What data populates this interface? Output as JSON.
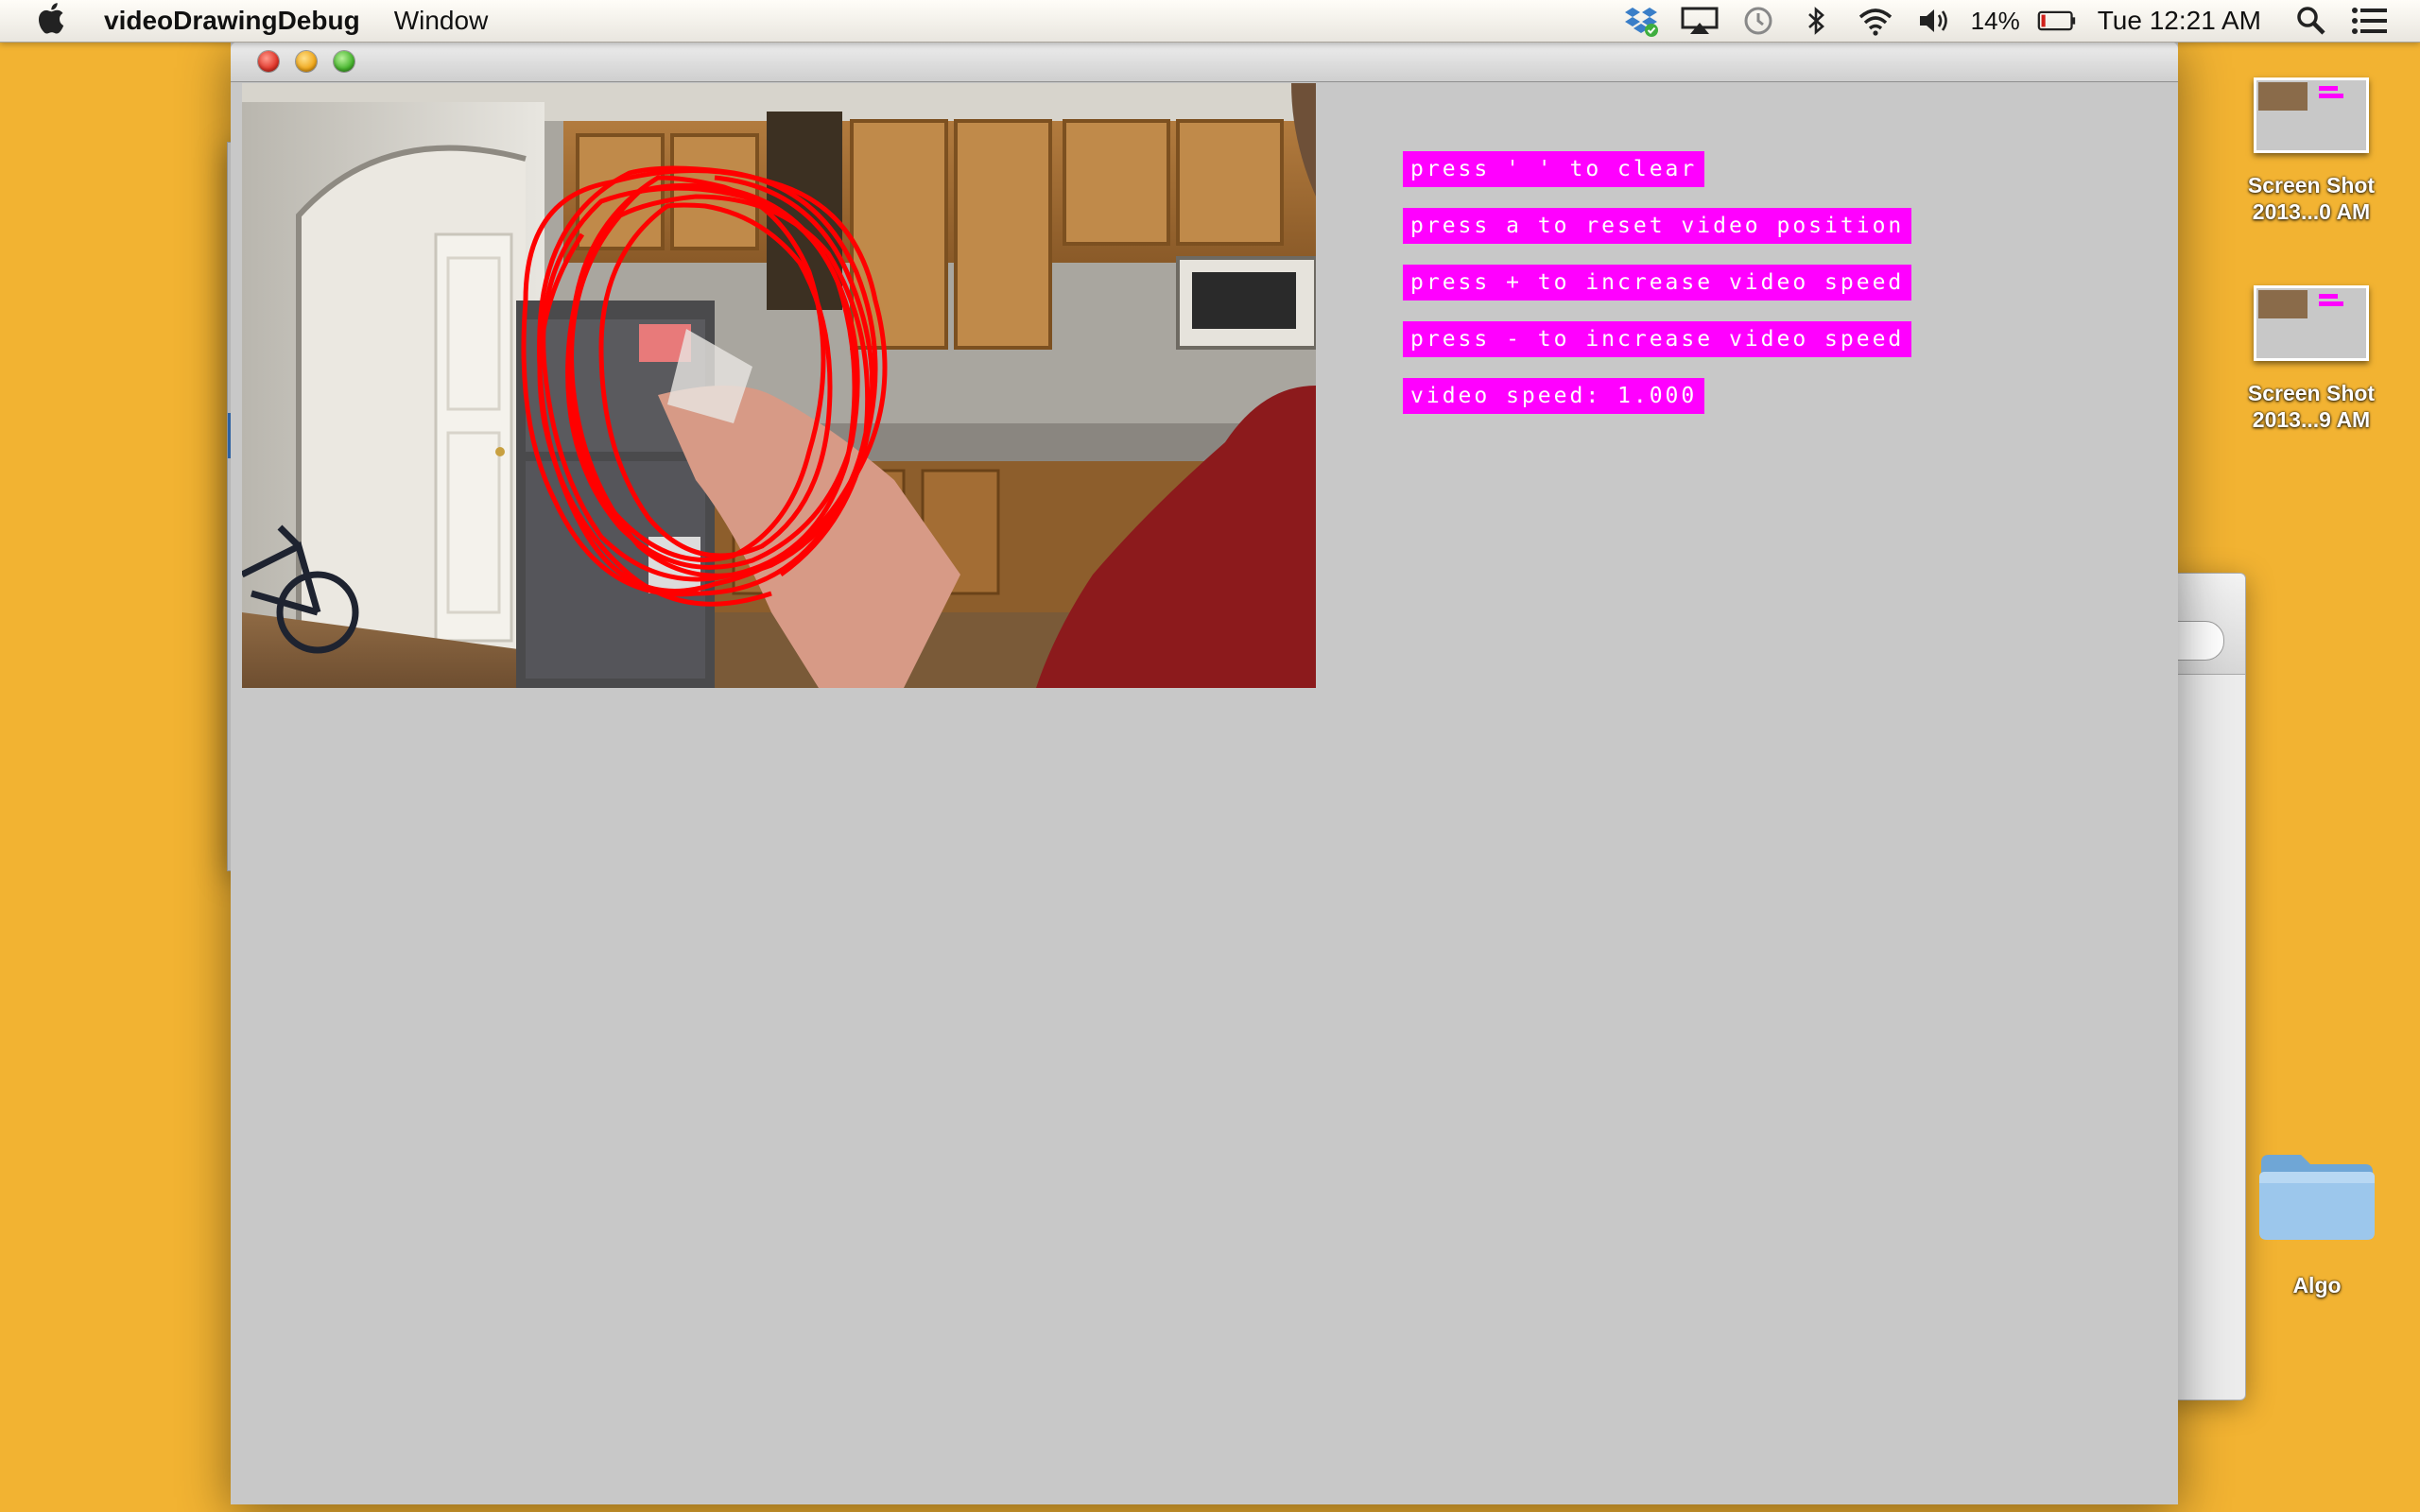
{
  "menubar": {
    "app_name": "videoDrawingDebug",
    "menus": [
      "Window"
    ],
    "status": {
      "battery_percent": "14%",
      "clock": "Tue 12:21 AM",
      "icons": [
        "dropbox-icon",
        "airplay-icon",
        "time-machine-icon",
        "bluetooth-icon",
        "wifi-icon",
        "volume-icon",
        "battery-icon",
        "spotlight-icon",
        "notification-center-icon"
      ]
    }
  },
  "window": {
    "labels": [
      "press ' ' to clear",
      "press a to reset video position",
      "press + to increase video speed",
      "press - to increase video speed",
      "video speed: 1.000"
    ],
    "label_color": "#ff00ff",
    "canvas_color": "#c8c8c8",
    "drawing_color": "#ff0000"
  },
  "desktop": {
    "background_color": "#f2b332",
    "icons": [
      {
        "label_line1": "Screen Shot",
        "label_line2": "2013...0 AM",
        "type": "screenshot"
      },
      {
        "label_line1": "Screen Shot",
        "label_line2": "2013...9 AM",
        "type": "screenshot"
      },
      {
        "label_line1": "Algo",
        "type": "folder"
      }
    ]
  }
}
